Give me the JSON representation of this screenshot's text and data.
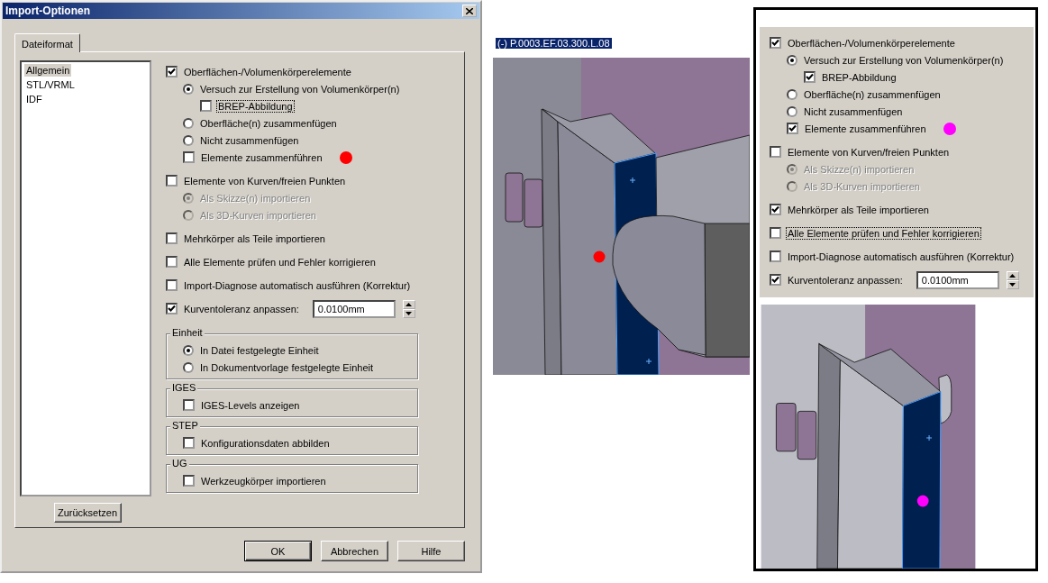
{
  "dialog": {
    "title": "Import-Optionen",
    "tabs": [
      {
        "label": "Dateiformat",
        "selected": true
      }
    ],
    "categories": [
      {
        "label": "Allgemein",
        "selected": true
      },
      {
        "label": "STL/VRML",
        "selected": false
      },
      {
        "label": "IDF",
        "selected": false
      }
    ],
    "reset_button": "Zurücksetzen",
    "options": [
      {
        "kind": "checkbox",
        "label": "Oberflächen-/Volumenkörperelemente",
        "checked": true,
        "children": [
          {
            "kind": "radio",
            "label": "Versuch zur Erstellung von Volumenkörper(n)",
            "selected": true,
            "children": [
              {
                "kind": "checkbox",
                "label": "BREP-Abbildung",
                "checked": false,
                "focused": true
              }
            ]
          },
          {
            "kind": "radio",
            "label": "Oberfläche(n) zusammenfügen",
            "selected": false
          },
          {
            "kind": "radio",
            "label": "Nicht zusammenfügen",
            "selected": false
          },
          {
            "kind": "checkbox",
            "label": "Elemente zusammenführen",
            "checked": false,
            "color": "#ff0000"
          }
        ]
      },
      {
        "kind": "checkbox",
        "label": "Elemente von Kurven/freien Punkten",
        "checked": false,
        "children": [
          {
            "kind": "radio",
            "label": "Als Skizze(n) importieren",
            "selected": true,
            "disabled": true
          },
          {
            "kind": "radio",
            "label": "Als 3D-Kurven importieren",
            "selected": false,
            "disabled": true
          }
        ]
      },
      {
        "kind": "checkbox",
        "label": "Mehrkörper als Teile importieren",
        "checked": false
      },
      {
        "kind": "checkbox",
        "label": "Alle Elemente prüfen und Fehler korrigieren",
        "checked": false
      },
      {
        "kind": "checkbox",
        "label": "Import-Diagnose automatisch ausführen (Korrektur)",
        "checked": false
      },
      {
        "kind": "checkbox-field",
        "label": "Kurventoleranz anpassen:",
        "checked": true,
        "value": "0.0100mm"
      }
    ],
    "groups": [
      {
        "title": "Einheit",
        "options": [
          {
            "kind": "radio",
            "label": "In Datei festgelegte Einheit",
            "selected": true
          },
          {
            "kind": "radio",
            "label": "In Dokumentvorlage festgelegte Einheit",
            "selected": false
          }
        ]
      },
      {
        "title": "IGES",
        "options": [
          {
            "kind": "checkbox",
            "label": "IGES-Levels anzeigen",
            "checked": false
          }
        ]
      },
      {
        "title": "STEP",
        "options": [
          {
            "kind": "checkbox",
            "label": "Konfigurationsdaten abbilden",
            "checked": false
          }
        ]
      },
      {
        "title": "UG",
        "options": [
          {
            "kind": "checkbox",
            "label": "Werkzeugkörper importieren",
            "checked": false
          }
        ]
      }
    ],
    "buttons": [
      {
        "label": "OK",
        "default": true
      },
      {
        "label": "Abbrechen",
        "default": false
      },
      {
        "label": "Hilfe",
        "default": false
      }
    ]
  },
  "selection_label": "(-) P.0003.EF.03.300.L.08",
  "model_views": [
    {
      "color": "#ff0000"
    },
    {
      "color": "#ff00ff"
    }
  ],
  "options_panel": {
    "options": [
      {
        "kind": "checkbox",
        "label": "Oberflächen-/Volumenkörperelemente",
        "checked": true,
        "children": [
          {
            "kind": "radio",
            "label": "Versuch zur Erstellung von Volumenkörper(n)",
            "selected": true,
            "children": [
              {
                "kind": "checkbox",
                "label": "BREP-Abbildung",
                "checked": true
              }
            ]
          },
          {
            "kind": "radio",
            "label": "Oberfläche(n) zusammenfügen",
            "selected": false
          },
          {
            "kind": "radio",
            "label": "Nicht zusammenfügen",
            "selected": false
          },
          {
            "kind": "checkbox",
            "label": "Elemente zusammenführen",
            "checked": true,
            "color": "#ff00ff"
          }
        ]
      },
      {
        "kind": "checkbox",
        "label": "Elemente von Kurven/freien Punkten",
        "checked": false,
        "children": [
          {
            "kind": "radio",
            "label": "Als Skizze(n) importieren",
            "selected": true,
            "disabled": true
          },
          {
            "kind": "radio",
            "label": "Als 3D-Kurven importieren",
            "selected": false,
            "disabled": true
          }
        ]
      },
      {
        "kind": "checkbox",
        "label": "Mehrkörper als Teile importieren",
        "checked": true
      },
      {
        "kind": "checkbox",
        "label": "Alle Elemente prüfen und Fehler korrigieren",
        "checked": false,
        "focused": true
      },
      {
        "kind": "checkbox",
        "label": "Import-Diagnose automatisch ausführen (Korrektur)",
        "checked": false
      },
      {
        "kind": "checkbox-field",
        "label": "Kurventoleranz anpassen:",
        "checked": true,
        "value": "0.0100mm"
      }
    ]
  }
}
